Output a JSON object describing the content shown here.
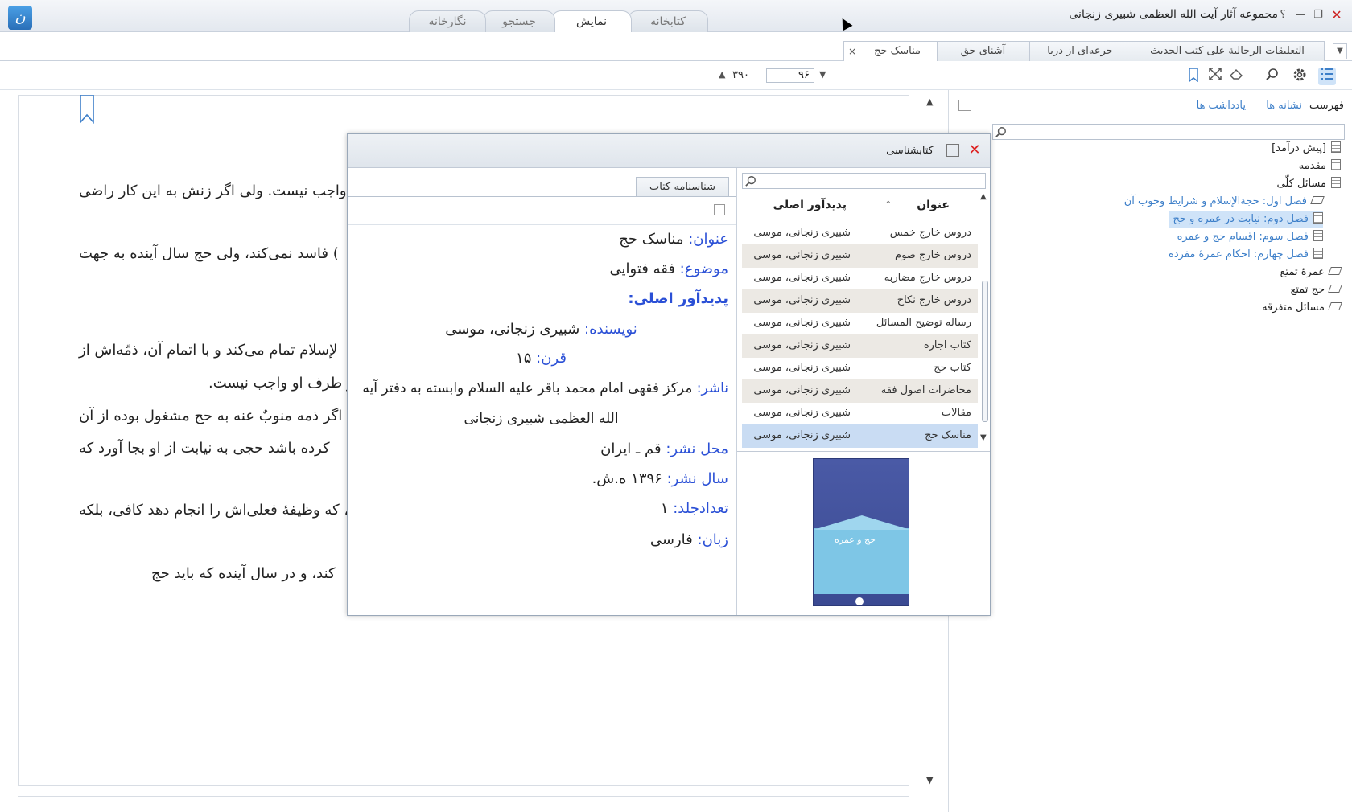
{
  "window": {
    "title": "مجموعه آثار آیت الله العظمی شبیری زنجانی",
    "help": "؟",
    "minimize": "—",
    "restore": "❐",
    "close": "✕"
  },
  "app_logo": "ن",
  "main_tabs": [
    {
      "label": "کتابخانه",
      "active": false
    },
    {
      "label": "نمایش",
      "active": true
    },
    {
      "label": "جستجو",
      "active": false
    },
    {
      "label": "نگارخانه",
      "active": false
    }
  ],
  "doc_tabs": [
    {
      "label": "التعلیقات الرجالیة علی کتب الحدیث"
    },
    {
      "label": "جرعه‌ای از دریا"
    },
    {
      "label": "آشنای حق"
    },
    {
      "label": "مناسک حج",
      "active": true
    }
  ],
  "doc_tab_close": "×",
  "doc_tab_menu": "▼",
  "toolbar": {
    "page_current": "۹۶",
    "page_total": "۳۹۰",
    "up_arrow": "▲",
    "down_arrow": "▼"
  },
  "reader": {
    "lines": [
      "واجب نیست. ولی اگر زنش به این کار راضی",
      ") فاسد نمی‌کند، ولی حج سال آینده به جهت",
      "لإسلام تمام می‌کند و با اتمام آن، ذمّه‌اش از",
      "ز طرف او واجب نیست.",
      "، اگر ذمه منوبٌ عنه به حج مشغول بوده از آن",
      " کرده باشد حجی به نیابت از او بجا آورد که",
      "، که وظیفهٔ فعلی‌اش را انجام دهد کافی، بلکه",
      "کند، و در سال آینده که باید حج"
    ],
    "scroll_up": "▲",
    "scroll_down": "▼"
  },
  "right_pane": {
    "title": "فهرست",
    "links": [
      "نشانه ها",
      "یادداشت ها"
    ],
    "tree": [
      {
        "label": "[پیش درآمد]",
        "level": 0,
        "link": false
      },
      {
        "label": "مقدمه",
        "level": 0,
        "link": false
      },
      {
        "label": "مسائل کلّی",
        "level": 0,
        "link": false
      },
      {
        "label": "فصل اول: حجةالإسلام و شرایط وجوب آن",
        "level": 1,
        "link": true
      },
      {
        "label": "فصل دوم: نیابت در عمره و حج",
        "level": 1,
        "link": true,
        "selected": true
      },
      {
        "label": "فصل سوم: اقسام حج و عمره",
        "level": 1,
        "link": true
      },
      {
        "label": "فصل چهارم: احکام عمرهٔ مفرده",
        "level": 1,
        "link": true
      },
      {
        "label": "عمرهٔ تمتع",
        "level": 0,
        "link": false
      },
      {
        "label": "حج تمتع",
        "level": 0,
        "link": false
      },
      {
        "label": "مسائل متفرقه",
        "level": 0,
        "link": false
      }
    ]
  },
  "dialog": {
    "title": "کتابشناسی",
    "close": "✕",
    "tab": "شناسنامه کتاب",
    "meta": [
      {
        "k": "عنوان:",
        "v": "مناسک حج"
      },
      {
        "k": "موضوع:",
        "v": "فقه فتوایی"
      },
      {
        "k": "پدیدآور اصلی:",
        "v": ""
      },
      {
        "k": "نویسنده:",
        "v": "شبیری زنجانی، موسی"
      },
      {
        "k": "قرن:",
        "v": "۱۵"
      },
      {
        "k": "ناشر:",
        "v": "مرکز فقهی امام محمد باقر علیه السلام وابسته به دفتر آیه"
      },
      {
        "k": "",
        "v": "الله العظمی شبیری زنجانی"
      },
      {
        "k": "محل نشر:",
        "v": "قم ـ ایران"
      },
      {
        "k": "سال نشر:",
        "v": "۱۳۹۶ ه.ش."
      },
      {
        "k": "تعدادجلد:",
        "v": "۱"
      },
      {
        "k": "زبان:",
        "v": "فارسی"
      }
    ],
    "list_headers": {
      "title": "عنوان",
      "author": "پدیدآور اصلی",
      "sort": "⌃"
    },
    "books": [
      {
        "title": "دروس خارج خمس",
        "author": "شبیری زنجانی، موسی"
      },
      {
        "title": "دروس خارج صوم",
        "author": "شبیری زنجانی، موسی"
      },
      {
        "title": "دروس خارج مضاربه",
        "author": "شبیری زنجانی، موسی"
      },
      {
        "title": "دروس خارج نکاح",
        "author": "شبیری زنجانی، موسی"
      },
      {
        "title": "رساله توضیح المسائل",
        "author": "شبیری زنجانی، موسی"
      },
      {
        "title": "کتاب اجاره",
        "author": "شبیری زنجانی، موسی"
      },
      {
        "title": "کتاب حج",
        "author": "شبیری زنجانی، موسی"
      },
      {
        "title": "محاضرات اصول فقه",
        "author": "شبیری زنجانی، موسی"
      },
      {
        "title": "مقالات",
        "author": "شبیری زنجانی، موسی"
      },
      {
        "title": "مناسک حج",
        "author": "شبیری زنجانی، موسی",
        "selected": true
      }
    ],
    "cover_title": "حج و عمره",
    "scroll_up": "▲",
    "scroll_down": "▼"
  },
  "colors": {
    "accent": "#3d7fc9",
    "selection": "#cfe3f8",
    "meta_key": "#2b50d6"
  }
}
